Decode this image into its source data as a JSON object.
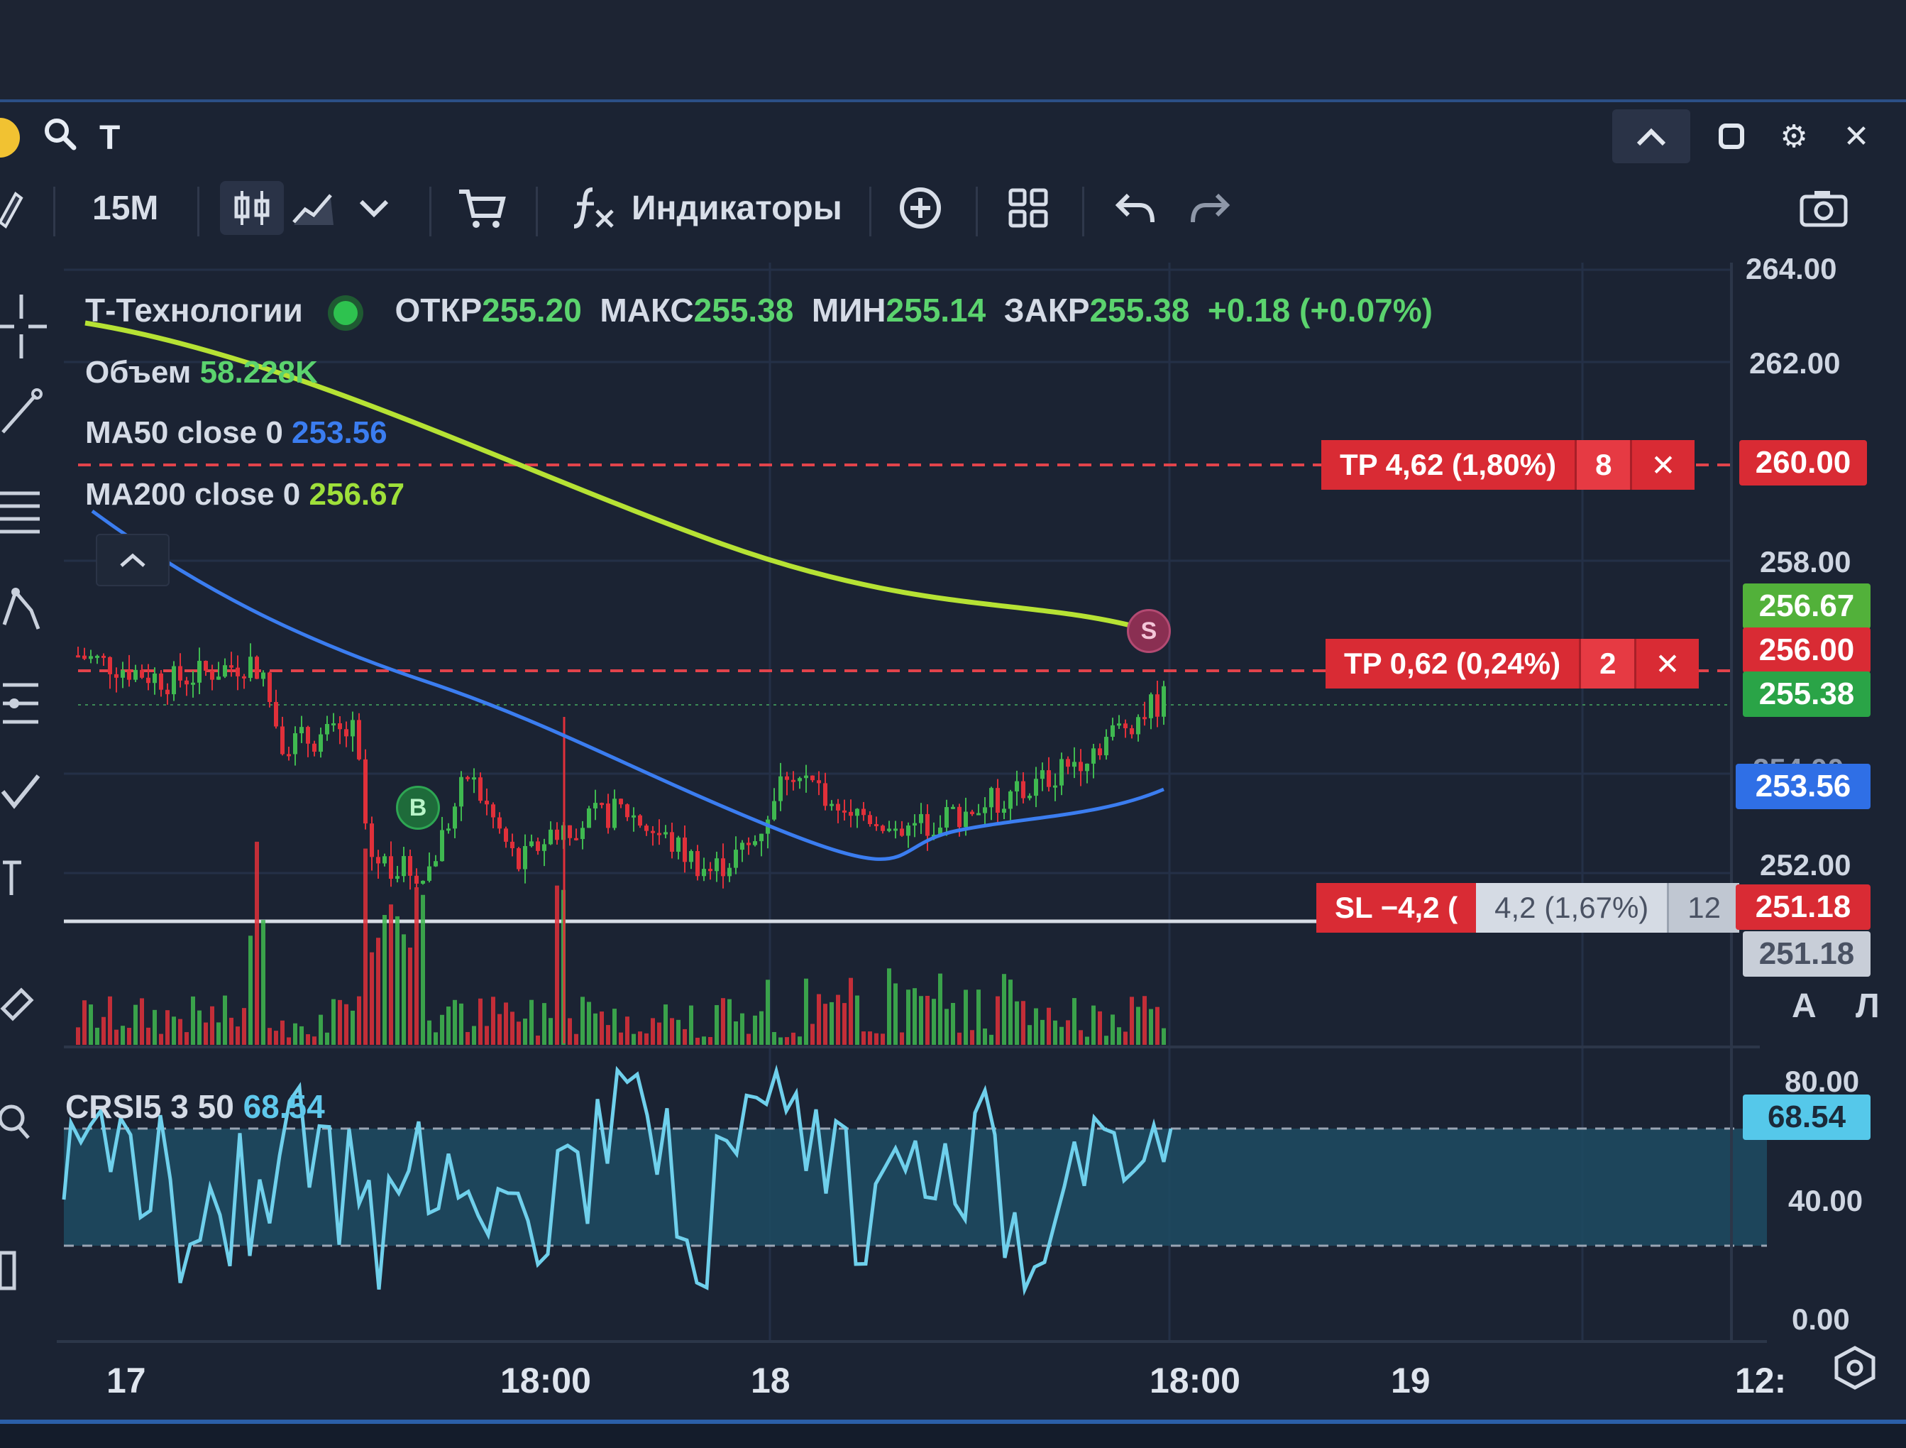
{
  "window": {
    "search_icon": "search-icon",
    "text_tool_label": "T",
    "controls": [
      "chevron-up-icon",
      "maximize-icon",
      "gear-icon",
      "close-icon"
    ]
  },
  "toolbar": {
    "timeframe": "15M",
    "indicators_label": "Индикаторы",
    "icons": [
      "pencil-icon",
      "candles-icon",
      "area-chart-icon",
      "chevron-down-icon",
      "cart-icon",
      "fx-icon",
      "plus-circle-icon",
      "layout-grid-icon",
      "undo-icon",
      "redo-icon",
      "camera-icon"
    ]
  },
  "instrument": {
    "name": "Т-Технологии",
    "open_label": "ОТКР",
    "open": "255.20",
    "high_label": "МАКС",
    "high": "255.38",
    "low_label": "МИН",
    "low": "255.14",
    "close_label": "ЗАКР",
    "close": "255.38",
    "change": "+0.18 (+0.07%)",
    "volume_label": "Объем",
    "volume": "58.228K",
    "ma50_label": "MA50 close 0",
    "ma50_value": "253.56",
    "ma200_label": "MA200 close 0",
    "ma200_value": "256.67"
  },
  "orders": {
    "tp1_label": "TP 4,62 (1,80%)",
    "tp1_qty": "8",
    "tp2_label": "TP 0,62 (0,24%)",
    "tp2_qty": "2",
    "sl_label": "SL −4,2 (",
    "sl_detail": "4,2 (1,67%)",
    "sl_qty": "12"
  },
  "price_axis": {
    "ticks": [
      "264.00",
      "262.00",
      "258.00",
      "252.00"
    ],
    "partial_tick": "254.00",
    "labels": {
      "tp1": "260.00",
      "ma200": "256.67",
      "tp2": "256.00",
      "last": "255.38",
      "ma50": "253.56",
      "sl": "251.18",
      "sl_ghost": "251.18"
    },
    "scale_buttons": [
      "А",
      "Л"
    ]
  },
  "oscillator": {
    "label": "CRSI5 3 50",
    "value": "68.54",
    "ticks": [
      "80.00",
      "40.00",
      "0.00"
    ]
  },
  "time_axis": {
    "ticks": [
      "17",
      "18:00",
      "18",
      "18:00",
      "19",
      "12:"
    ]
  },
  "markers": {
    "buy": "B",
    "sell": "S"
  },
  "colors": {
    "up": "#3fb950",
    "down": "#e0303a",
    "ma50": "#3b7df0",
    "ma200": "#b6e234",
    "crsi": "#6fd0ec"
  },
  "chart_data": {
    "type": "candlestick",
    "series": [
      {
        "name": "MA200 close 0",
        "last": 256.67
      },
      {
        "name": "MA50 close 0",
        "last": 253.56
      }
    ],
    "price_levels": {
      "tp1": 260.0,
      "tp2": 256.0,
      "last": 255.38,
      "sl": 251.18
    },
    "ylim": [
      250.5,
      264.5
    ],
    "oscillator_ylim": [
      0,
      100
    ]
  }
}
